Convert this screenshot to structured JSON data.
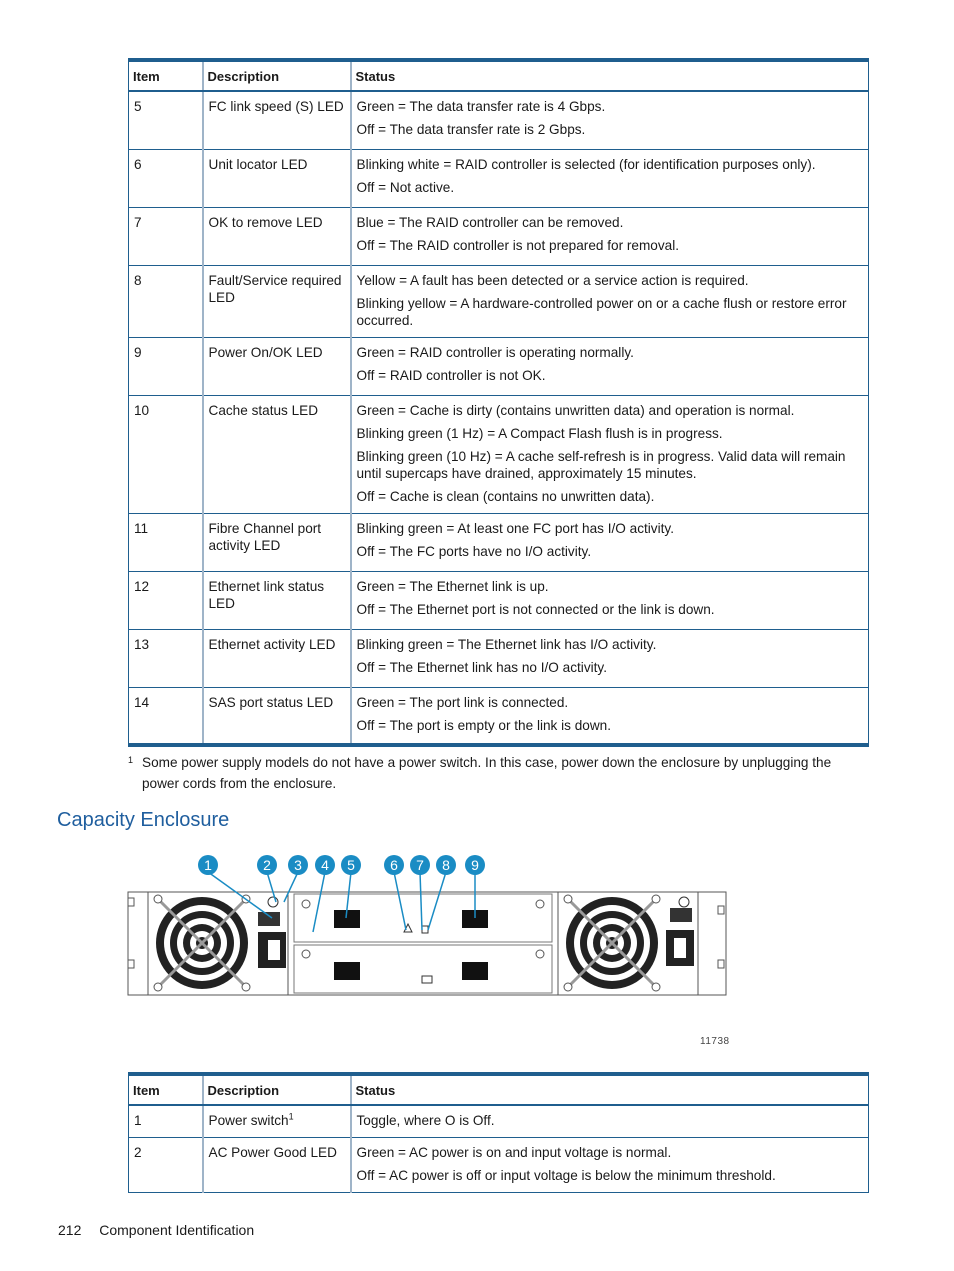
{
  "table1": {
    "headers": [
      "Item",
      "Description",
      "Status"
    ],
    "rows": [
      {
        "item": "5",
        "description": "FC link speed (S) LED",
        "status": [
          "Green = The data transfer rate is 4 Gbps.",
          "Off = The data transfer rate is 2 Gbps."
        ]
      },
      {
        "item": "6",
        "description": "Unit locator LED",
        "status": [
          "Blinking white = RAID controller is selected (for identification purposes only).",
          "Off = Not active."
        ]
      },
      {
        "item": "7",
        "description": "OK to remove LED",
        "status": [
          "Blue = The RAID controller can be removed.",
          "Off = The RAID controller is not prepared for removal."
        ]
      },
      {
        "item": "8",
        "description": "Fault/Service required LED",
        "status": [
          "Yellow = A fault has been detected or a service action is required.",
          "Blinking yellow = A hardware-controlled power on or a cache flush or restore error occurred."
        ]
      },
      {
        "item": "9",
        "description": "Power On/OK LED",
        "status": [
          "Green = RAID controller is operating normally.",
          "Off = RAID controller is not OK."
        ]
      },
      {
        "item": "10",
        "description": "Cache status LED",
        "status": [
          "Green = Cache is dirty (contains unwritten data) and operation is normal.",
          "Blinking green (1 Hz) = A Compact Flash flush is in progress.",
          "Blinking green (10 Hz) = A cache self-refresh is in progress. Valid data will remain until supercaps have drained, approximately 15 minutes.",
          "Off = Cache is clean (contains no unwritten data)."
        ]
      },
      {
        "item": "11",
        "description": "Fibre Channel port activity LED",
        "status": [
          "Blinking green = At least one FC port has I/O activity.",
          "Off = The FC ports have no I/O activity."
        ]
      },
      {
        "item": "12",
        "description": "Ethernet link status LED",
        "status": [
          "Green = The Ethernet link is up.",
          "Off = The Ethernet port is not connected or the link is down."
        ]
      },
      {
        "item": "13",
        "description": "Ethernet activity LED",
        "status": [
          "Blinking green = The Ethernet link has I/O activity.",
          "Off = The Ethernet link has no I/O activity."
        ]
      },
      {
        "item": "14",
        "description": "SAS port status LED",
        "status": [
          "Green = The port link is connected.",
          "Off = The port is empty or the link is down."
        ]
      }
    ]
  },
  "footnote": {
    "marker": "1",
    "text": "Some power supply models do not have a power switch. In this case, power down the enclosure by unplugging the power cords from the enclosure."
  },
  "section_title": "Capacity Enclosure",
  "figure": {
    "callouts": [
      "1",
      "2",
      "3",
      "4",
      "5",
      "6",
      "7",
      "8",
      "9"
    ],
    "figure_id": "11738"
  },
  "table2": {
    "headers": [
      "Item",
      "Description",
      "Status"
    ],
    "rows": [
      {
        "item": "1",
        "description": "Power switch",
        "footnote_ref": "1",
        "status": [
          "Toggle, where O is Off."
        ]
      },
      {
        "item": "2",
        "description": "AC Power Good LED",
        "status": [
          "Green = AC power is on and input voltage is normal.",
          "Off = AC power is off or input voltage is below the minimum threshold."
        ]
      }
    ]
  },
  "footer": {
    "page_number": "212",
    "chapter": "Component Identification"
  },
  "colors": {
    "accent": "#1f5e8e",
    "heading": "#1f5e9e",
    "callout": "#1a8cc4"
  }
}
